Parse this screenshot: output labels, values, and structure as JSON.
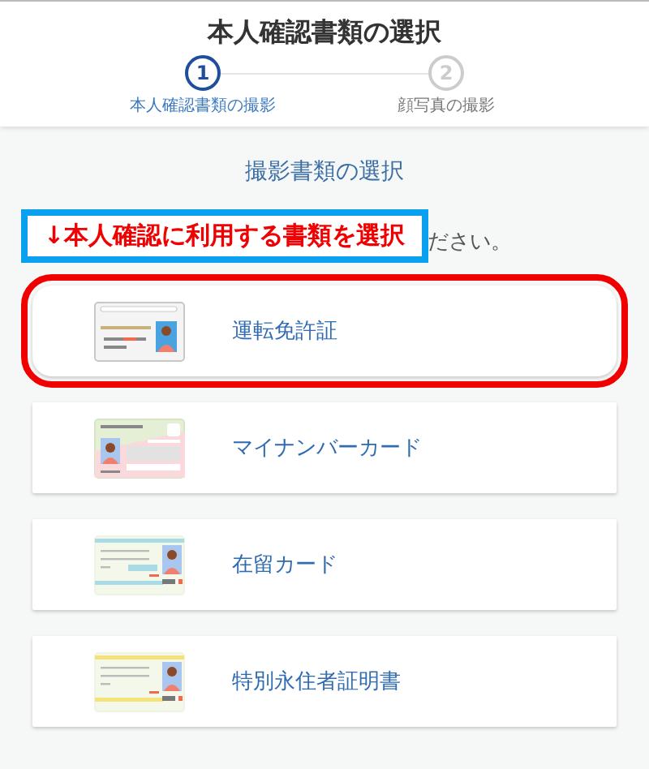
{
  "header": {
    "title": "本人確認書類の選択"
  },
  "steps": [
    {
      "number": "1",
      "label": "本人確認書類の撮影",
      "selected": true
    },
    {
      "number": "2",
      "label": "顔写真の撮影",
      "selected": false
    }
  ],
  "section_title": "撮影書類の選択",
  "annotation": {
    "text": "↓本人確認に利用する書類を選択"
  },
  "instruction_tail": "ださい。",
  "documents": [
    {
      "label": "運転免許証",
      "kind": "license",
      "highlighted": true
    },
    {
      "label": "マイナンバーカード",
      "kind": "mynumber",
      "highlighted": false
    },
    {
      "label": "在留カード",
      "kind": "residence",
      "highlighted": false
    },
    {
      "label": "特別永住者証明書",
      "kind": "special",
      "highlighted": false
    }
  ]
}
